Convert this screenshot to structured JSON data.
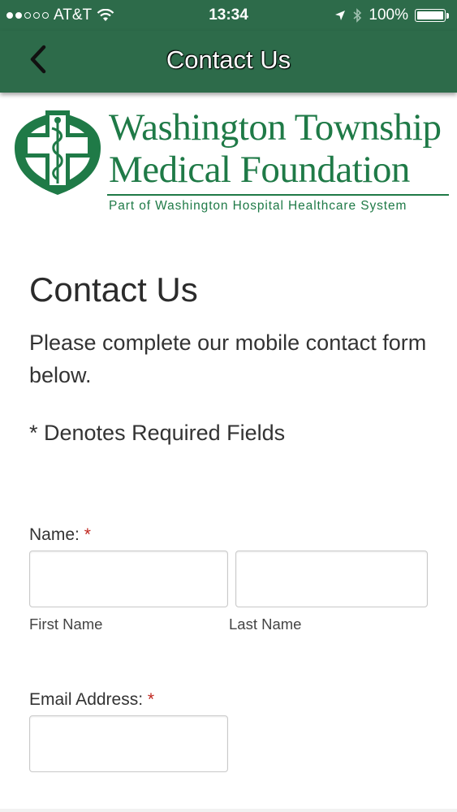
{
  "status_bar": {
    "carrier": "AT&T",
    "time": "13:34",
    "battery": "100%",
    "battery_level": 1.0,
    "signal_bars_filled": 2,
    "signal_bars_total": 5
  },
  "nav": {
    "back_icon": "chevron-left-icon",
    "title": "Contact Us"
  },
  "logo": {
    "line1": "Washington Township",
    "line2": "Medical Foundation",
    "tagline": "Part of Washington Hospital Healthcare System",
    "color": "#1f7a47"
  },
  "content": {
    "heading": "Contact Us",
    "intro": "Please complete our mobile contact form below.",
    "required_note": "* Denotes Required Fields"
  },
  "form": {
    "name_label": "Name:",
    "required_marker": "*",
    "first_name": {
      "value": "",
      "sublabel": "First Name"
    },
    "last_name": {
      "value": "",
      "sublabel": "Last Name"
    },
    "email_label": "Email Address:",
    "email": {
      "value": ""
    }
  },
  "colors": {
    "header": "#2d6b4a",
    "required": "#c0261e"
  }
}
